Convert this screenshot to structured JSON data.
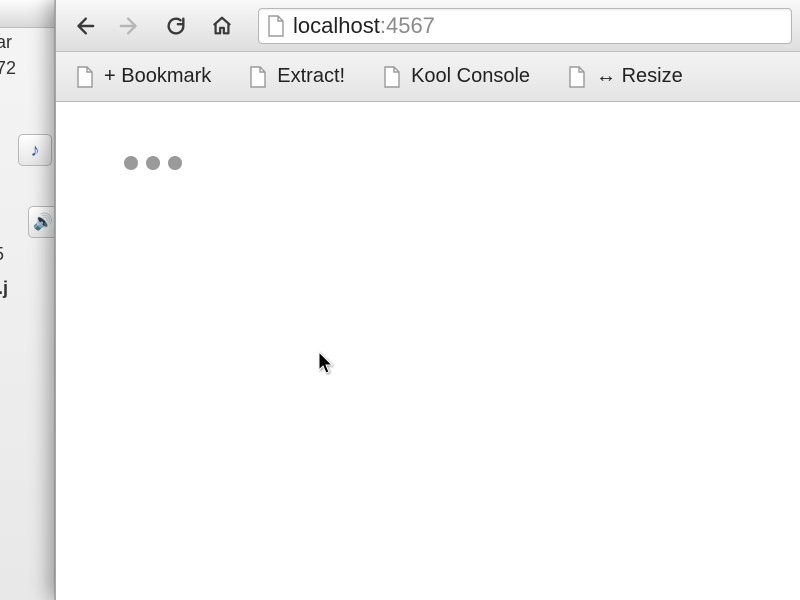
{
  "url": {
    "host": "localhost",
    "port": "4567"
  },
  "nav": {
    "back_enabled": true,
    "forward_enabled": false
  },
  "bookmarks": [
    {
      "label": "+ Bookmark"
    },
    {
      "label": "Extract!"
    },
    {
      "label": "Kool Console"
    },
    {
      "label": "↔ Resize"
    }
  ],
  "bg": {
    "frag1": "ar",
    "frag2": "72",
    "frag3": "5",
    "frag4": ".j"
  }
}
